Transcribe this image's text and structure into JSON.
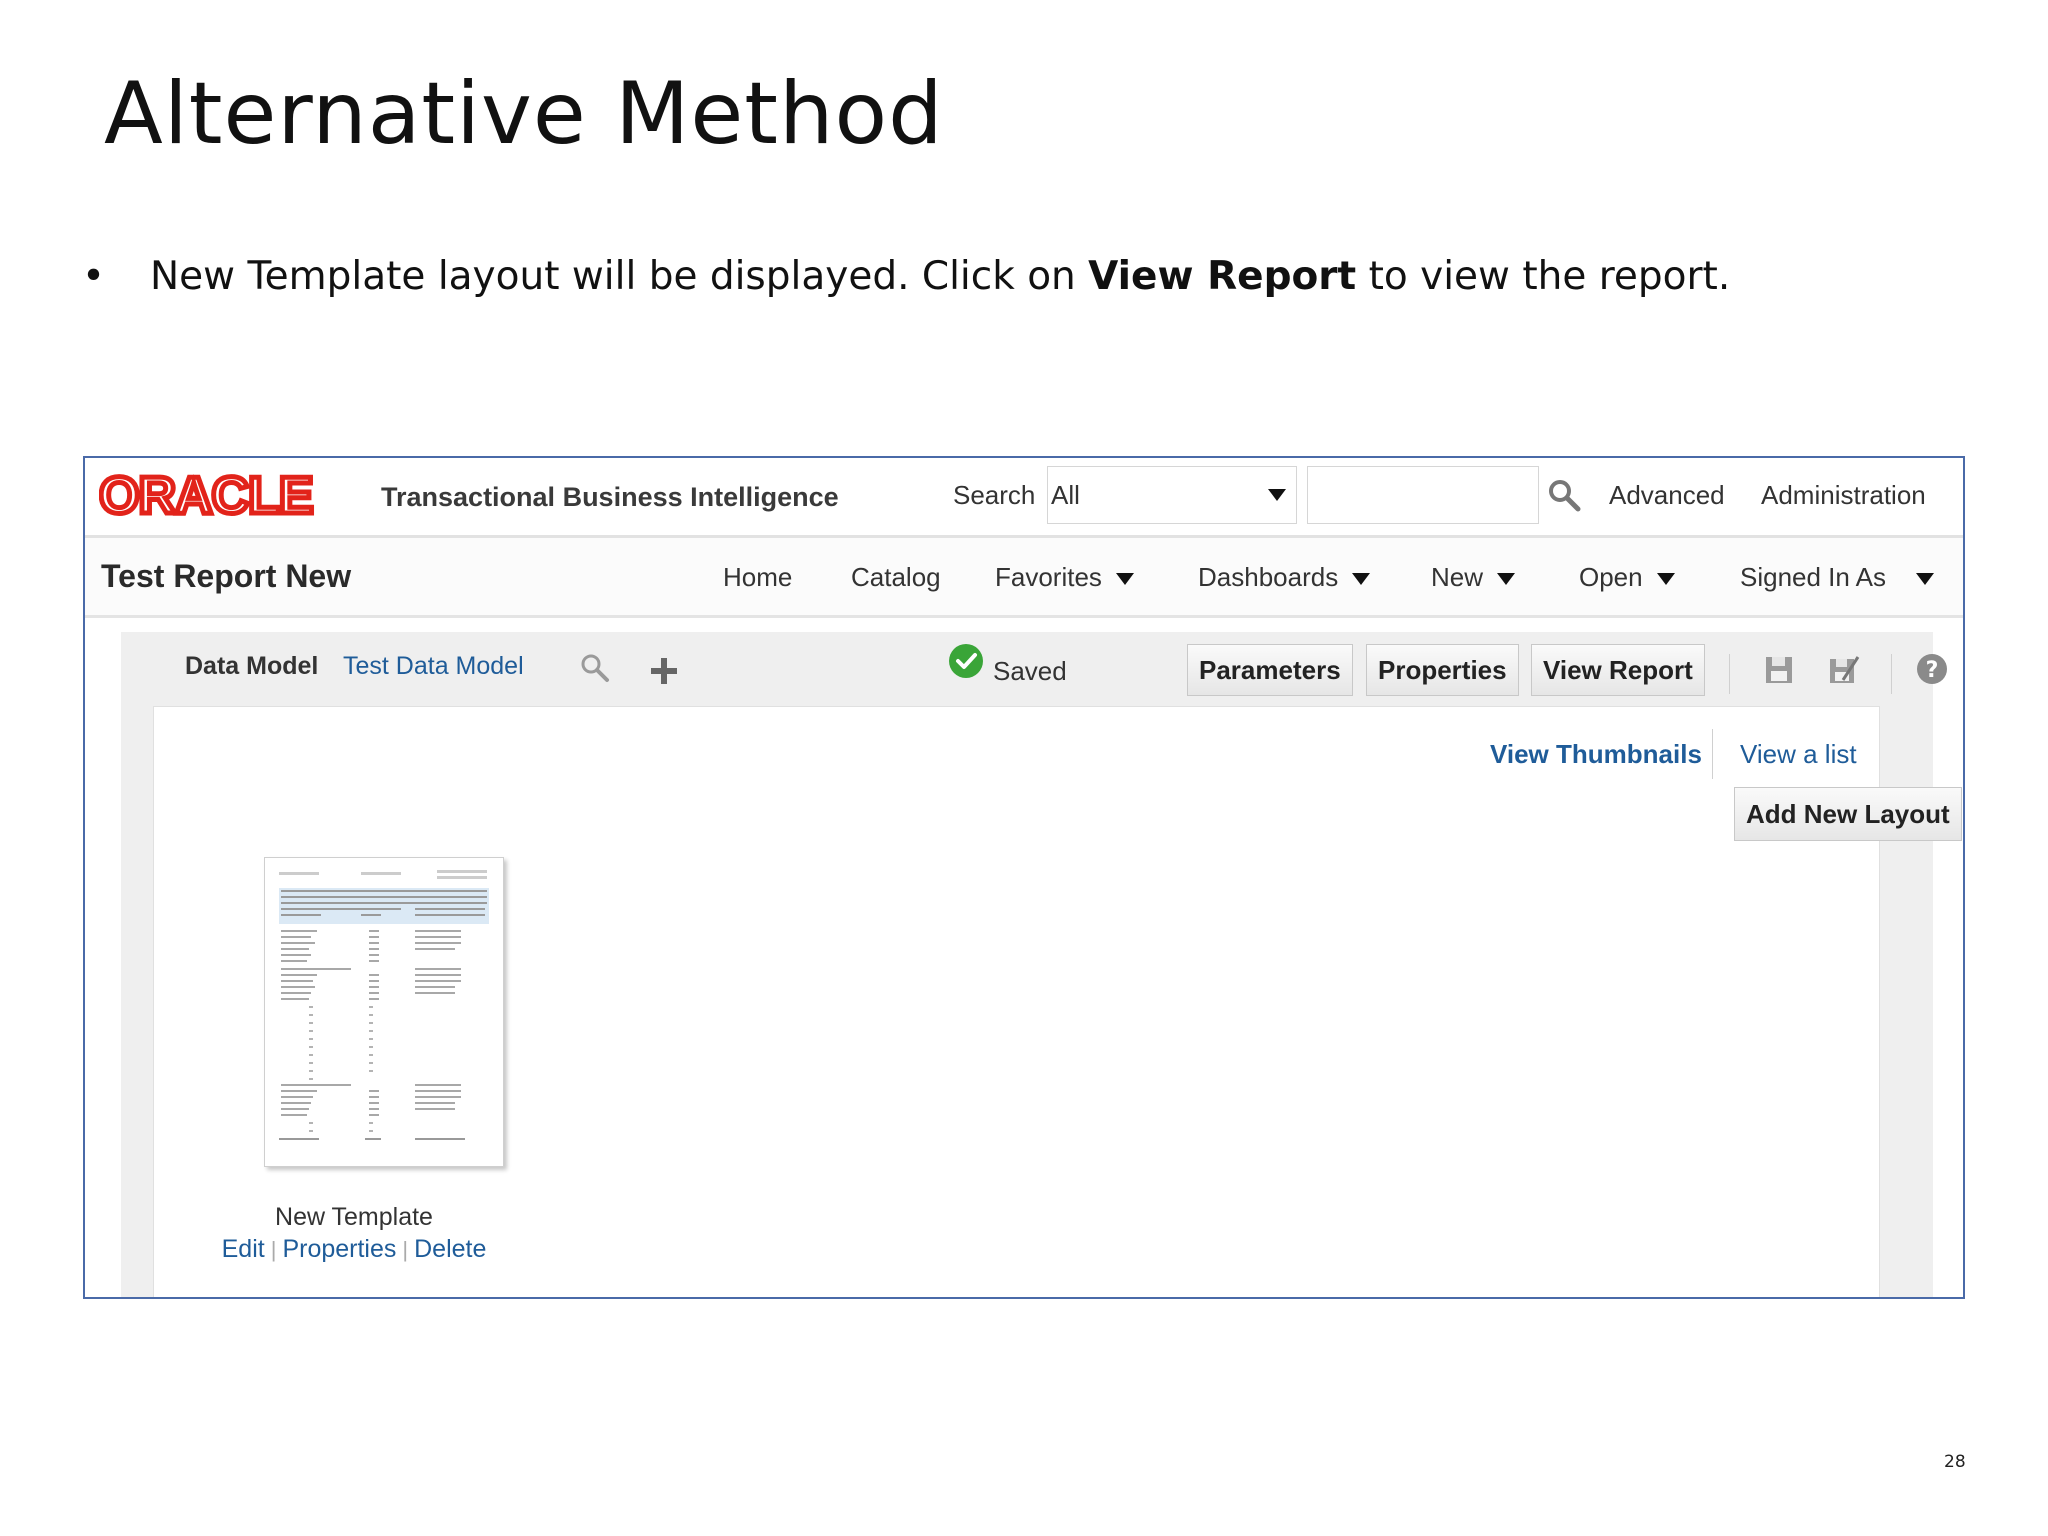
{
  "slide": {
    "title": "Alternative Method",
    "bullet_pre": "New Template layout will be displayed. Click on ",
    "bullet_bold": "View Report",
    "bullet_post": " to view the report.",
    "page_number": "28"
  },
  "header": {
    "brand_logo_text": "ORACLE",
    "product_name": "Transactional Business Intelligence",
    "search_label": "Search",
    "search_scope": "All",
    "search_value": "",
    "links": {
      "advanced": "Advanced",
      "administration": "Administration"
    }
  },
  "navbar": {
    "report_title": "Test Report New",
    "items": [
      "Home",
      "Catalog",
      "Favorites",
      "Dashboards",
      "New",
      "Open",
      "Signed In As"
    ]
  },
  "toolbar": {
    "data_model_label": "Data Model",
    "data_model_link": "Test Data Model",
    "saved_label": "Saved",
    "parameters": "Parameters",
    "properties": "Properties",
    "view_report": "View Report",
    "icons": [
      "search-icon",
      "add-icon",
      "check-icon",
      "save-icon",
      "save-as-icon",
      "help-icon"
    ]
  },
  "layouts": {
    "view_thumbnails": "View Thumbnails",
    "view_list": "View a list",
    "add_new_layout": "Add New Layout",
    "template": {
      "name": "New Template",
      "edit": "Edit",
      "properties": "Properties",
      "delete": "Delete"
    }
  },
  "colors": {
    "oracle_red": "#e2231a",
    "link_blue": "#1f5c99",
    "saved_green": "#3aa538",
    "frame_border": "#4a6aa8"
  }
}
